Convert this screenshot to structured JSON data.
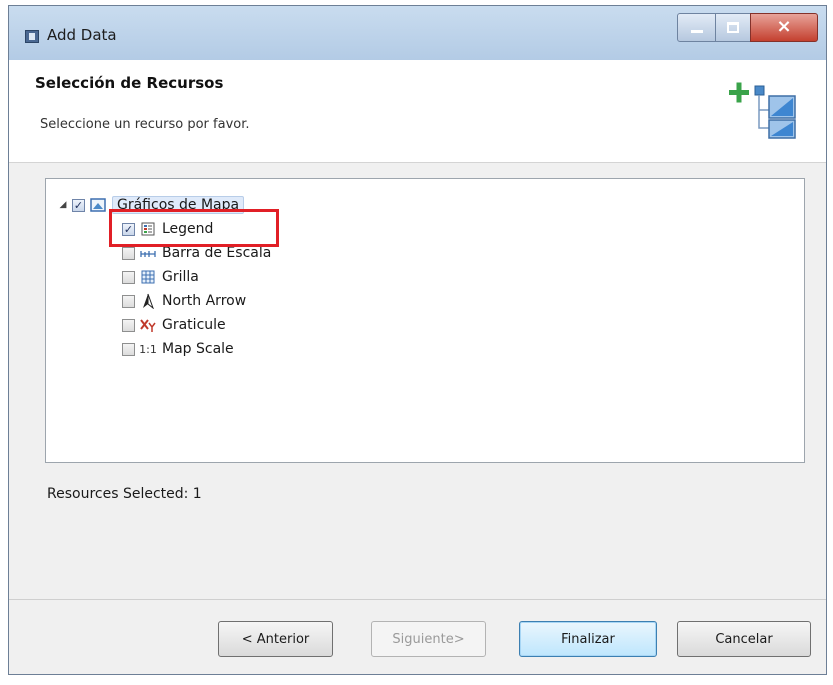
{
  "window": {
    "title": "Add Data"
  },
  "header": {
    "title": "Selección de Recursos",
    "description": "Seleccione un recurso por favor."
  },
  "tree": {
    "root": {
      "label": "Gráficos de Mapa",
      "checked": true,
      "icon": "map-graphics-folder-icon"
    },
    "items": [
      {
        "label": "Legend",
        "checked": true,
        "icon": "legend-icon"
      },
      {
        "label": "Barra de Escala",
        "checked": false,
        "icon": "scale-bar-icon"
      },
      {
        "label": "Grilla",
        "checked": false,
        "icon": "grid-icon"
      },
      {
        "label": "North Arrow",
        "checked": false,
        "icon": "north-arrow-icon"
      },
      {
        "label": "Graticule",
        "checked": false,
        "icon": "graticule-icon"
      },
      {
        "label": "Map Scale",
        "checked": false,
        "icon": "map-scale-icon",
        "icon_text": "1:1"
      }
    ]
  },
  "status": {
    "text": "Resources Selected: 1"
  },
  "buttons": {
    "back": "< Anterior",
    "next": "Siguiente>",
    "finish": "Finalizar",
    "cancel": "Cancelar"
  },
  "colors": {
    "highlight": "#e11f26",
    "accent": "#3c7fb1"
  }
}
